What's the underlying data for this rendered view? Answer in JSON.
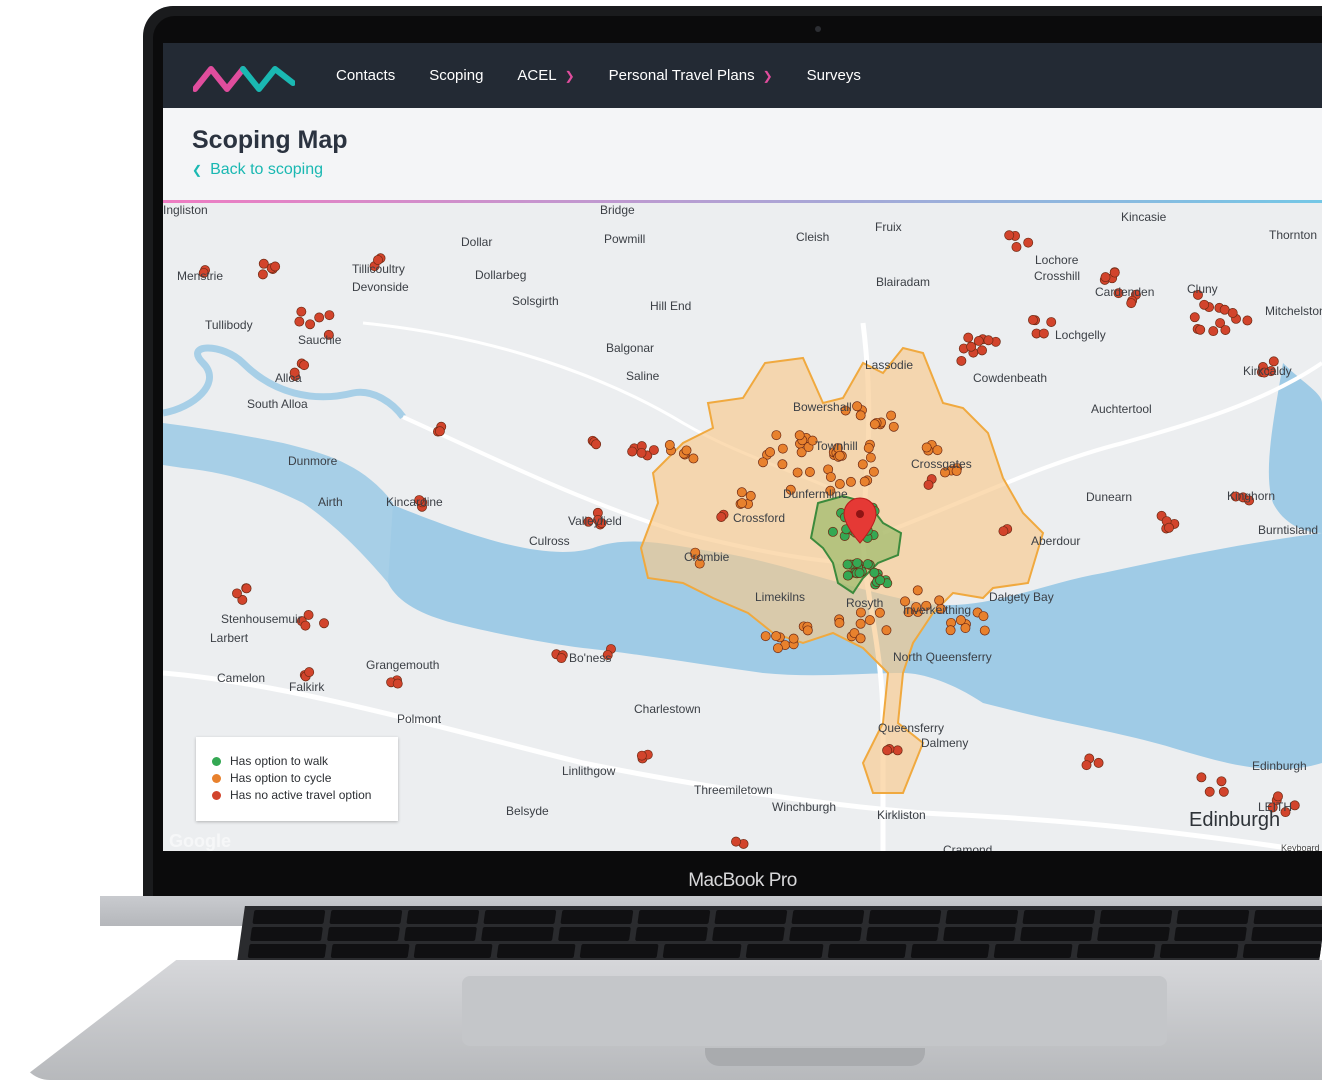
{
  "device": {
    "brand_label": "MacBook Pro"
  },
  "nav": {
    "items": [
      {
        "label": "Contacts",
        "dropdown": false
      },
      {
        "label": "Scoping",
        "dropdown": false
      },
      {
        "label": "ACEL",
        "dropdown": true
      },
      {
        "label": "Personal Travel Plans",
        "dropdown": true
      },
      {
        "label": "Surveys",
        "dropdown": false
      }
    ]
  },
  "header": {
    "title": "Scoping Map",
    "back_link": "Back to scoping"
  },
  "colors": {
    "nav_bg": "#232a34",
    "accent_teal": "#1ab8b2",
    "accent_pink": "#e04d9d",
    "walk": "#34a853",
    "cycle": "#e8812d",
    "no_active": "#d2442c",
    "catchment": "#f9c98c"
  },
  "map": {
    "place_labels": [
      "Bridge",
      "Kincasie",
      "Thornton",
      "Fruix",
      "Dollar",
      "Powmill",
      "Cleish",
      "Menstrie",
      "Tillicoultry",
      "Devonside",
      "Dollarbeg",
      "Blairadam",
      "Lochore",
      "Crosshill",
      "Cardenden",
      "Cluny",
      "Solsgirth",
      "Hill End",
      "Mitchelston Industrial",
      "Tullibody",
      "Sauchie",
      "Balgonar",
      "Saline",
      "Lassodie",
      "Lochgelly",
      "Alloa",
      "Cowdenbeath",
      "Kirkcaldy",
      "South Alloa",
      "Bowershall",
      "Auchtertool",
      "Dunmore",
      "Townhill",
      "Crossgates",
      "Dunearn",
      "Kinghorn",
      "Airth",
      "Kincardine",
      "Dunfermline",
      "Valleyfield",
      "Crossford",
      "Culross",
      "Burntisland",
      "Aberdour",
      "Crombie",
      "Limekilns",
      "Rosyth",
      "Inverkeithing",
      "Dalgety Bay",
      "Stenhousemuir",
      "Larbert",
      "North Queensferry",
      "Grangemouth",
      "Bo'ness",
      "Camelon",
      "Falkirk",
      "Charlestown",
      "Polmont",
      "Queensferry",
      "Dalmeny",
      "Linlithgow",
      "Threemiletown",
      "Winchburgh",
      "Kirkliston",
      "Belsyde",
      "Edinburgh",
      "LEITH",
      "Cramond",
      "Ingliston"
    ],
    "edinburgh_label": "Edinburgh",
    "attribution": "Google",
    "keyboard_note": "Keyboard",
    "legend": [
      {
        "label": "Has option to walk",
        "color": "#34a853"
      },
      {
        "label": "Has option to cycle",
        "color": "#e8812d"
      },
      {
        "label": "Has no active travel option",
        "color": "#d2442c"
      }
    ]
  }
}
